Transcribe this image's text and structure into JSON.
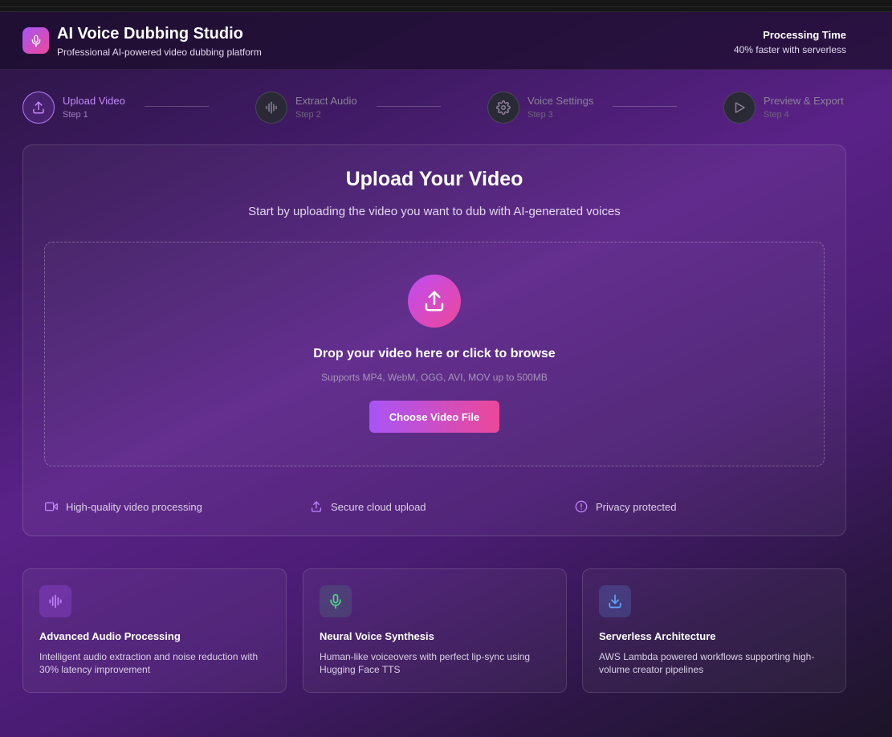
{
  "header": {
    "title": "AI Voice Dubbing Studio",
    "subtitle": "Professional AI-powered video dubbing platform",
    "stat_label": "Processing Time",
    "stat_value": "40% faster with serverless"
  },
  "steps": [
    {
      "label": "Upload Video",
      "sub": "Step 1",
      "icon": "upload-icon",
      "active": true
    },
    {
      "label": "Extract Audio",
      "sub": "Step 2",
      "icon": "waveform-icon",
      "active": false
    },
    {
      "label": "Voice Settings",
      "sub": "Step 3",
      "icon": "gear-icon",
      "active": false
    },
    {
      "label": "Preview & Export",
      "sub": "Step 4",
      "icon": "play-icon",
      "active": false
    }
  ],
  "upload": {
    "title": "Upload Your Video",
    "subtitle": "Start by uploading the video you want to dub with AI-generated voices",
    "drop_title": "Drop your video here or click to browse",
    "drop_hint": "Supports MP4, WebM, OGG, AVI, MOV up to 500MB",
    "button_label": "Choose Video File",
    "features": [
      {
        "icon": "video-icon",
        "label": "High-quality video processing"
      },
      {
        "icon": "upload-icon",
        "label": "Secure cloud upload"
      },
      {
        "icon": "alert-circle-icon",
        "label": "Privacy protected"
      }
    ]
  },
  "info_cards": [
    {
      "icon": "waveform-icon",
      "title": "Advanced Audio Processing",
      "desc": "Intelligent audio extraction and noise reduction with 30% latency improvement",
      "accent": "#c084fc"
    },
    {
      "icon": "microphone-icon",
      "title": "Neural Voice Synthesis",
      "desc": "Human-like voiceovers with perfect lip-sync using Hugging Face TTS",
      "accent": "#4ade80"
    },
    {
      "icon": "download-icon",
      "title": "Serverless Architecture",
      "desc": "AWS Lambda powered workflows supporting high-volume creator pipelines",
      "accent": "#60a5fa"
    }
  ],
  "colors": {
    "accent_purple": "#a855f7",
    "accent_pink": "#ec4899",
    "active_step": "#c28af7"
  }
}
